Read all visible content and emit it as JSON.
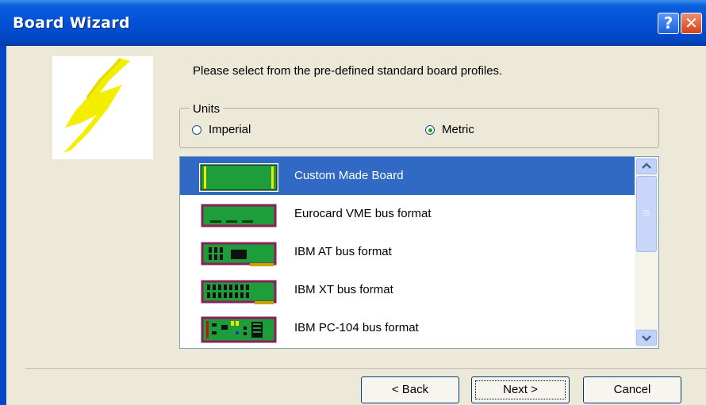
{
  "window": {
    "title": "Board Wizard"
  },
  "titlebar": {
    "help_label": "?",
    "close_label": "✕"
  },
  "instruction": "Please select from the pre-defined standard board profiles.",
  "units": {
    "legend": "Units",
    "imperial_label": "Imperial",
    "metric_label": "Metric",
    "selected": "Metric"
  },
  "board_list": {
    "items": [
      {
        "label": "Custom Made Board",
        "icon": "custom-board-icon",
        "selected": true
      },
      {
        "label": "Eurocard VME bus format",
        "icon": "eurocard-board-icon",
        "selected": false
      },
      {
        "label": "IBM AT bus format",
        "icon": "ibm-at-board-icon",
        "selected": false
      },
      {
        "label": "IBM XT bus format",
        "icon": "ibm-xt-board-icon",
        "selected": false
      },
      {
        "label": "IBM PC-104 bus format",
        "icon": "pc104-board-icon",
        "selected": false
      }
    ]
  },
  "buttons": {
    "back": "< Back",
    "next": "Next >",
    "cancel": "Cancel"
  },
  "colors": {
    "selection": "#316ac5",
    "titlebar": "#0350d6",
    "board_green": "#1e9e3a",
    "board_border": "#8a1f5a"
  }
}
